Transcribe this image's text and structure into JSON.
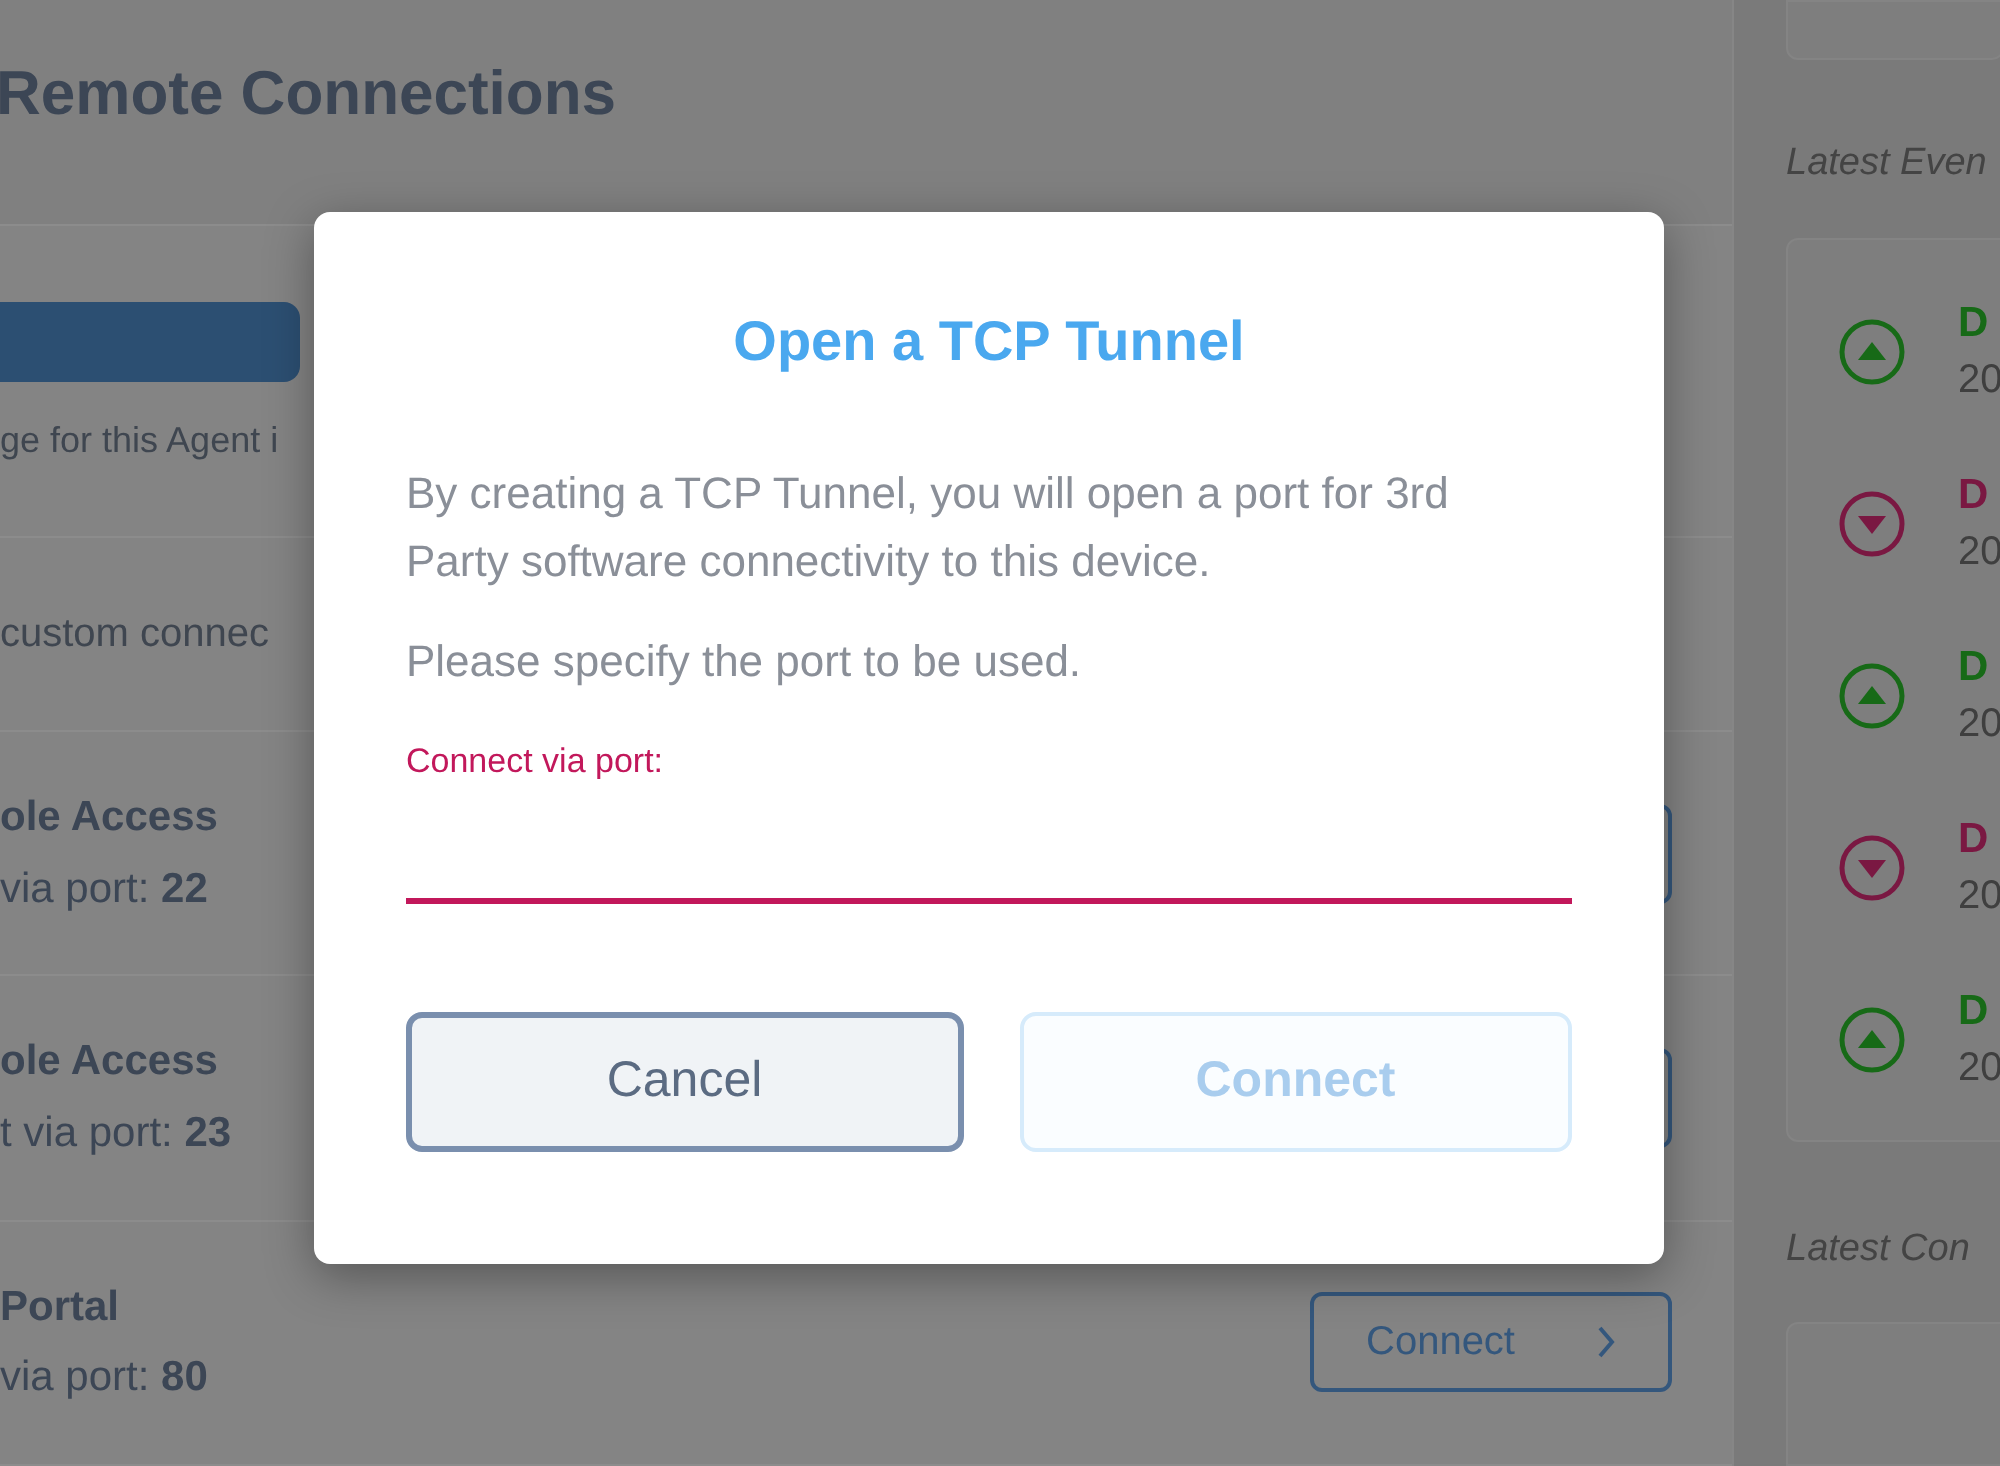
{
  "page": {
    "title": "Remote Connections"
  },
  "agent_card": {
    "note": "ge for this Agent i"
  },
  "custom_row": {
    "text": "custom connec"
  },
  "connections": [
    {
      "name": "ole Access",
      "detail": "via port: **22**"
    },
    {
      "name": "ole Access",
      "detail": "t via port: **23**"
    },
    {
      "name": "Portal",
      "detail": "via port: **80**",
      "button": "Connect"
    }
  ],
  "sidebar": {
    "events_heading": "Latest Even",
    "events": [
      {
        "kind": "up",
        "title": "D",
        "date": "20"
      },
      {
        "kind": "down",
        "title": "D",
        "date": "20"
      },
      {
        "kind": "up",
        "title": "D",
        "date": "20"
      },
      {
        "kind": "down",
        "title": "D",
        "date": "20"
      },
      {
        "kind": "up",
        "title": "D",
        "date": "20"
      }
    ],
    "connections_heading": "Latest Con"
  },
  "dialog": {
    "title": "Open a TCP Tunnel",
    "paragraphs": [
      "By creating a TCP Tunnel, you will open a port for 3rd Party software connectivity to this device.",
      "Please specify the port to be used."
    ],
    "field": {
      "label": "Connect via port:"
    },
    "buttons": [
      {
        "label": "Cancel",
        "disabled": false
      },
      {
        "label": "Connect",
        "disabled": true
      }
    ]
  }
}
